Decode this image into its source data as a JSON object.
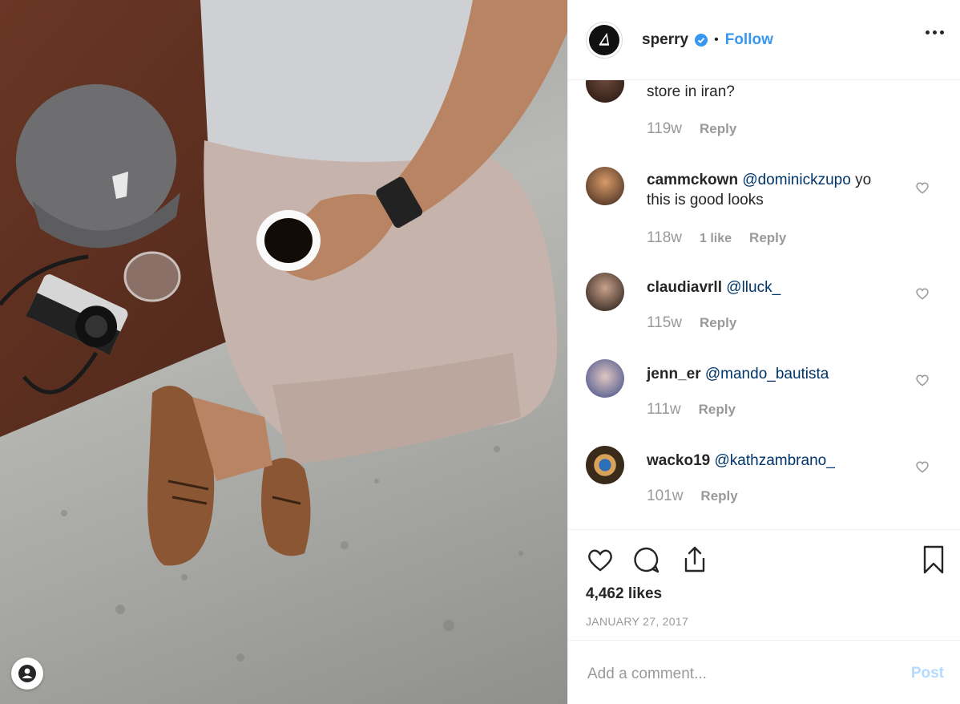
{
  "header": {
    "username": "sperry",
    "separator": "•",
    "follow_label": "Follow",
    "verified_icon": "verified-badge-icon",
    "more_icon": "more-options-icon"
  },
  "comments": [
    {
      "user": "",
      "text": "store in iran?",
      "time": "119w",
      "likes": "",
      "reply": "Reply"
    },
    {
      "user": "cammckown",
      "mention": "@dominickzupo",
      "text_after": " yo this is good looks",
      "time": "118w",
      "likes": "1 like",
      "reply": "Reply"
    },
    {
      "user": "claudiavrll",
      "mention": "@lluck_",
      "time": "115w",
      "reply": "Reply"
    },
    {
      "user": "jenn_er",
      "mention": "@mando_bautista",
      "time": "111w",
      "reply": "Reply"
    },
    {
      "user": "wacko19",
      "mention": "@kathzambrano_",
      "time": "101w",
      "reply": "Reply"
    }
  ],
  "actions": {
    "like_icon": "heart-icon",
    "comment_icon": "comment-bubble-icon",
    "share_icon": "share-icon",
    "save_icon": "bookmark-icon"
  },
  "post": {
    "likes": "4,462 likes",
    "date": "JANUARY 27, 2017"
  },
  "add_comment": {
    "placeholder": "Add a comment...",
    "post_label": "Post"
  },
  "colors": {
    "accent": "#3897f0",
    "mention": "#003569",
    "muted": "#999999",
    "post_disabled": "#b3dbff"
  }
}
